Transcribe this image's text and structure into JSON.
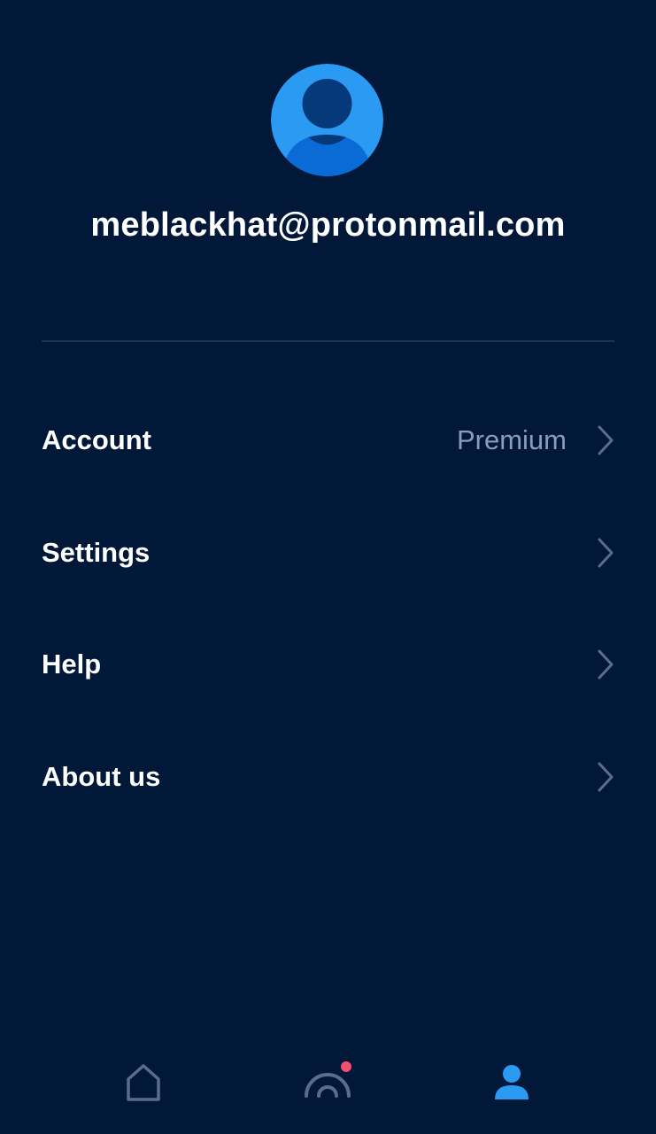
{
  "profile": {
    "email": "meblackhat@protonmail.com",
    "avatar_icon": "user-avatar-icon"
  },
  "menu": {
    "items": [
      {
        "label": "Account",
        "value": "Premium",
        "icon": "chevron-right-icon"
      },
      {
        "label": "Settings",
        "value": "",
        "icon": "chevron-right-icon"
      },
      {
        "label": "Help",
        "value": "",
        "icon": "chevron-right-icon"
      },
      {
        "label": "About us",
        "value": "",
        "icon": "chevron-right-icon"
      }
    ]
  },
  "tabbar": {
    "tabs": [
      {
        "icon": "home-icon",
        "active": false
      },
      {
        "icon": "connection-icon",
        "active": false,
        "notification": true
      },
      {
        "icon": "profile-icon",
        "active": true
      }
    ]
  },
  "colors": {
    "background": "#021838",
    "accent": "#2b9af3",
    "muted": "#8b9bb8",
    "notification": "#f0506e"
  }
}
